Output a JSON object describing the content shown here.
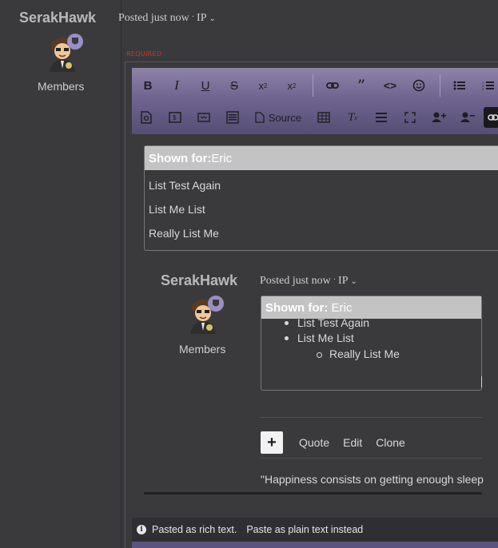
{
  "post": {
    "author": "SerakHawk",
    "role": "Members",
    "meta_posted": "Posted just now",
    "meta_ip": "IP",
    "required_label": "REQUIRED"
  },
  "toolbar": {
    "row1": [
      "bold-icon",
      "italic-icon",
      "underline-icon",
      "strikethrough-icon",
      "subscript-icon",
      "superscript-icon",
      "link-icon",
      "quote-icon",
      "code-icon",
      "emoji-icon",
      "bullet-list-icon",
      "numbered-list-icon"
    ],
    "row2": [
      "preview-icon",
      "spoiler-icon",
      "embed-icon",
      "template-icon",
      "source-icon",
      "table-icon",
      "remove-format-icon",
      "horizontal-rule-icon",
      "fullscreen-icon",
      "add-user-icon",
      "remove-user-icon",
      "link-dark-icon"
    ],
    "source_label": "Source"
  },
  "spoiler1": {
    "heading_bold": "Shown for:",
    "heading_value": "Eric",
    "items": [
      "List Test Again",
      "List Me List",
      "Really List Me"
    ]
  },
  "nested": {
    "author": "SerakHawk",
    "role": "Members",
    "meta_posted": "Posted just now",
    "meta_ip": "IP",
    "spoiler_heading_bold": "Shown for:",
    "spoiler_heading_value": "Eric",
    "list": [
      "List Test Again",
      "List Me List",
      "Really List Me"
    ],
    "controls": {
      "quote": "Quote",
      "edit": "Edit",
      "clone": "Clone"
    },
    "quote_text": "\"Happiness consists on getting enough sleep"
  },
  "paste_bar": {
    "message": "Pasted as rich text.",
    "link": "Paste as plain text instead"
  },
  "colors": {
    "toolbar_top": "#8e83a8",
    "toolbar_bottom": "#564e74",
    "badge": "#9a8ec4",
    "required": "#c0392b"
  }
}
